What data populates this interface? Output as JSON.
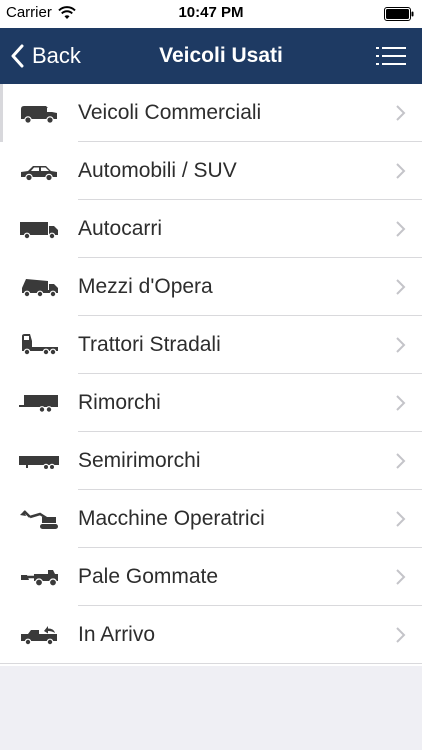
{
  "status_bar": {
    "carrier": "Carrier",
    "time": "10:47 PM"
  },
  "nav": {
    "back_label": "Back",
    "title": "Veicoli Usati",
    "bar_color": "#1e3a63"
  },
  "list": {
    "items": [
      {
        "label": "Veicoli Commerciali",
        "icon": "van-icon"
      },
      {
        "label": "Automobili / SUV",
        "icon": "car-icon"
      },
      {
        "label": "Autocarri",
        "icon": "truck-icon"
      },
      {
        "label": "Mezzi d'Opera",
        "icon": "dump-truck-icon"
      },
      {
        "label": "Trattori Stradali",
        "icon": "tractor-unit-icon"
      },
      {
        "label": "Rimorchi",
        "icon": "trailer-icon"
      },
      {
        "label": "Semirimorchi",
        "icon": "semitrailer-icon"
      },
      {
        "label": "Macchine Operatrici",
        "icon": "excavator-icon"
      },
      {
        "label": "Pale Gommate",
        "icon": "wheel-loader-icon"
      },
      {
        "label": "In Arrivo",
        "icon": "incoming-truck-icon"
      }
    ]
  }
}
